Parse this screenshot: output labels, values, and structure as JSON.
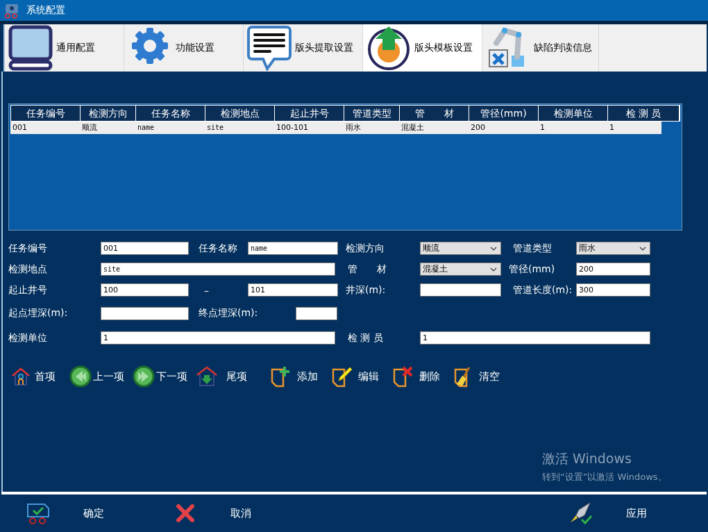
{
  "window": {
    "title": "系统配置"
  },
  "tabs": [
    {
      "label": "通用配置",
      "kind": "monitor",
      "selected": false
    },
    {
      "label": "功能设置",
      "kind": "gear",
      "selected": false
    },
    {
      "label": "版头提取设置",
      "kind": "speech",
      "selected": false
    },
    {
      "label": "版头模板设置",
      "kind": "upload",
      "selected": true
    },
    {
      "label": "缺陷判读信息",
      "kind": "robot",
      "selected": false
    }
  ],
  "table": {
    "columns": [
      "任务编号",
      "检测方向",
      "任务名称",
      "检测地点",
      "起止井号",
      "管道类型",
      "管　　材",
      "管径(mm)",
      "检测单位",
      "检 测 员"
    ],
    "rows": [
      {
        "selected": true,
        "cells": [
          "001",
          "顺流",
          "name",
          "site",
          "100-101",
          "雨水",
          "混凝土",
          "200",
          "1",
          "1"
        ]
      }
    ]
  },
  "form": {
    "rows": [
      {
        "fields": [
          {
            "label": "任务编号",
            "kind": "text",
            "value": "001"
          },
          {
            "label": "任务名称",
            "kind": "text",
            "value": "name"
          },
          {
            "label": "检测方向",
            "kind": "select",
            "value": "顺流"
          },
          {
            "label": "管道类型",
            "kind": "select",
            "value": "雨水"
          }
        ]
      },
      {
        "fields": [
          {
            "label": "检测地点",
            "kind": "text",
            "value": "site"
          },
          {
            "label": "管　　材",
            "kind": "select",
            "value": "混凝土"
          },
          {
            "label": "管径(mm)",
            "kind": "text",
            "value": "200"
          }
        ]
      },
      {
        "fields": [
          {
            "label": "起止井号",
            "kind": "range",
            "from": "100",
            "separator": "–",
            "to": "101"
          },
          {
            "label": "井深(m):",
            "kind": "text"
          },
          {
            "label": "管道长度(m):",
            "kind": "text",
            "value": "300"
          }
        ]
      },
      {
        "fields": [
          {
            "label": "起点埋深(m):",
            "kind": "text"
          },
          {
            "label": "终点埋深(m):",
            "kind": "text"
          }
        ]
      },
      {
        "fields": [
          {
            "label": "检测单位",
            "kind": "text",
            "value": "1"
          },
          {
            "label": "检 测 员",
            "kind": "text",
            "value": "1"
          }
        ]
      }
    ]
  },
  "toolbar": [
    {
      "label": "首项",
      "kind": "first"
    },
    {
      "label": "上一项",
      "kind": "prev"
    },
    {
      "label": "下一项",
      "kind": "next"
    },
    {
      "label": "尾项",
      "kind": "last"
    },
    {
      "label": "添加",
      "kind": "add"
    },
    {
      "label": "编辑",
      "kind": "edit"
    },
    {
      "label": "删除",
      "kind": "delete"
    },
    {
      "label": "清空",
      "kind": "clear"
    }
  ],
  "activation_notice": {
    "title": "激活 Windows",
    "message": "转到“设置”以激活 Windows。"
  },
  "footer": [
    {
      "label": "确定",
      "kind": "ok"
    },
    {
      "label": "取消",
      "kind": "cancel"
    },
    {
      "label": "应用",
      "kind": "apply"
    }
  ]
}
